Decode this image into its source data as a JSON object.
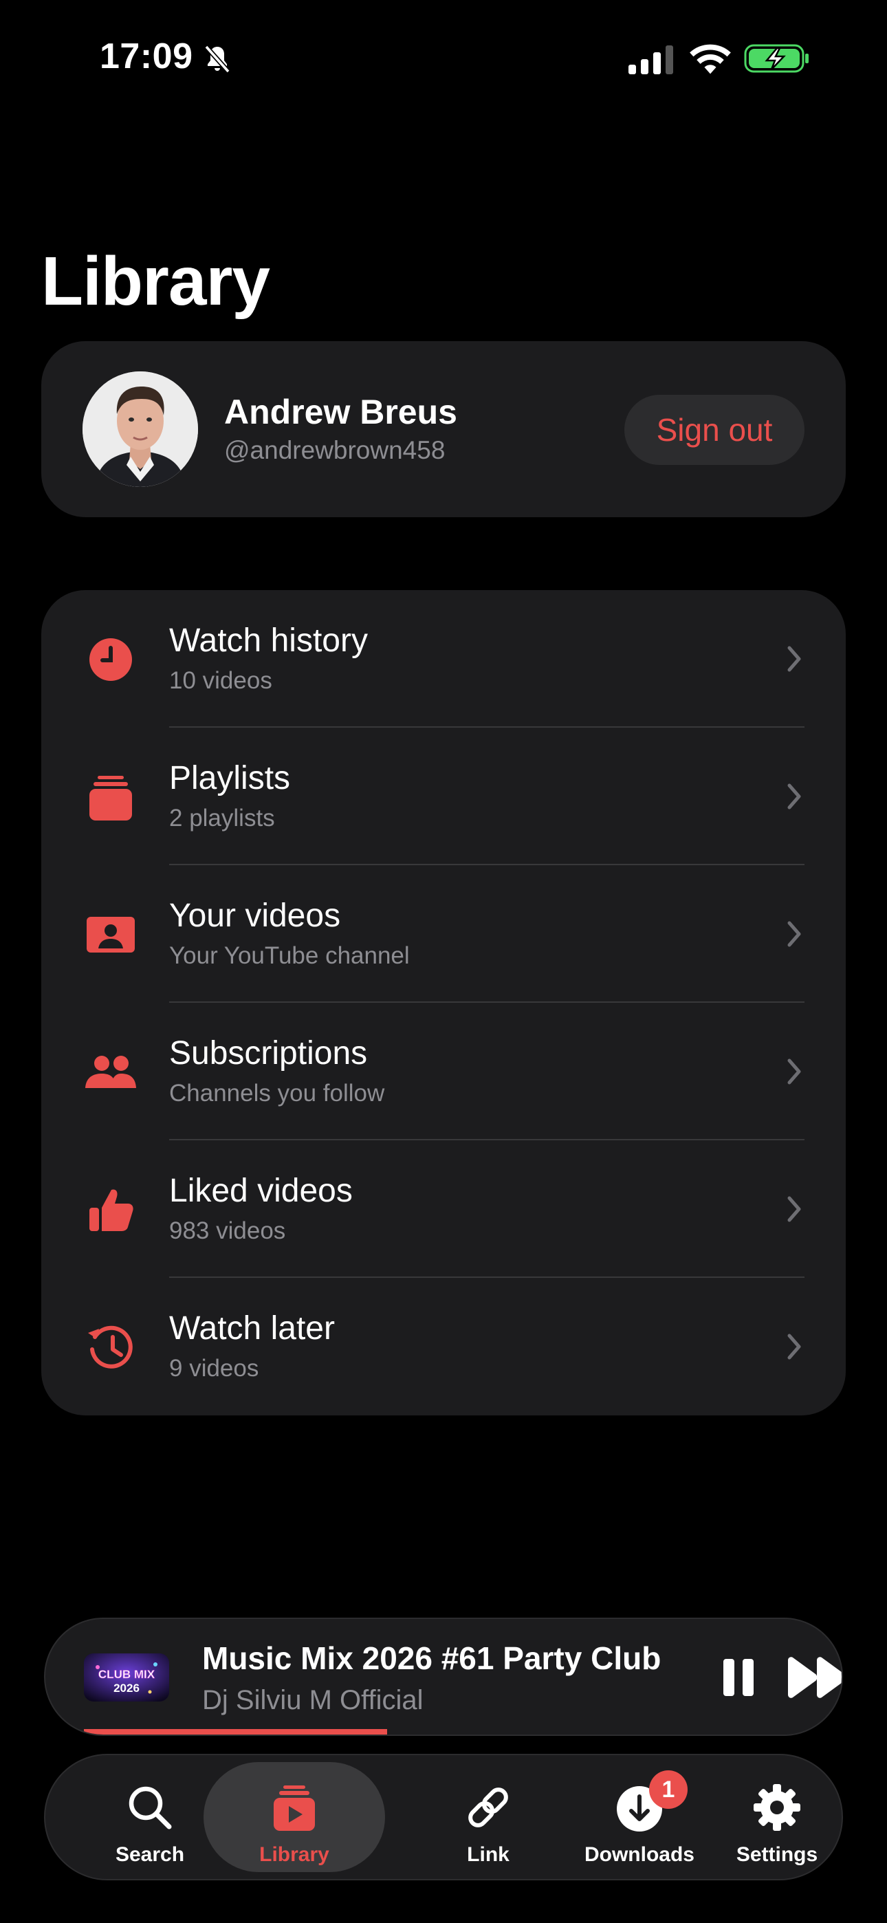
{
  "status_bar": {
    "time": "17:09"
  },
  "page": {
    "title": "Library"
  },
  "profile": {
    "name": "Andrew Breus",
    "handle": "@andrewbrown458",
    "sign_out_label": "Sign out"
  },
  "library_items": [
    {
      "title": "Watch history",
      "subtitle": "10 videos",
      "icon": "clock-icon"
    },
    {
      "title": "Playlists",
      "subtitle": "2 playlists",
      "icon": "playlist-stack-icon"
    },
    {
      "title": "Your videos",
      "subtitle": "Your YouTube channel",
      "icon": "person-card-icon"
    },
    {
      "title": "Subscriptions",
      "subtitle": "Channels you follow",
      "icon": "people-icon"
    },
    {
      "title": "Liked videos",
      "subtitle": "983 videos",
      "icon": "thumbs-up-icon"
    },
    {
      "title": "Watch later",
      "subtitle": "9 videos",
      "icon": "history-clock-icon"
    }
  ],
  "now_playing": {
    "title": "Music Mix 2026 #61 Party Club",
    "artist": "Dj Silviu M Official",
    "thumbnail_text": [
      "CLUB MIX",
      "2026"
    ],
    "progress": 0.42
  },
  "tabs": [
    {
      "label": "Search",
      "icon": "search-icon",
      "active": false
    },
    {
      "label": "Library",
      "icon": "library-icon",
      "active": true
    },
    {
      "label": "Link",
      "icon": "link-icon",
      "active": false
    },
    {
      "label": "Downloads",
      "icon": "download-icon",
      "active": false,
      "badge": "1"
    },
    {
      "label": "Settings",
      "icon": "gear-icon",
      "active": false
    }
  ],
  "colors": {
    "accent": "#ea4f4c",
    "card": "#1c1c1e",
    "secondary_text": "#8e8e93",
    "battery": "#4cd964"
  }
}
